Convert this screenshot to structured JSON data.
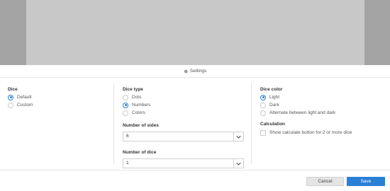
{
  "settings_bar": {
    "label": "Settings",
    "icon": "gear-icon"
  },
  "dice": {
    "title": "Dice",
    "options": [
      {
        "label": "Default",
        "checked": true
      },
      {
        "label": "Custom",
        "checked": false
      }
    ]
  },
  "dice_type": {
    "title": "Dice type",
    "options": [
      {
        "label": "Dots",
        "checked": false
      },
      {
        "label": "Numbers",
        "checked": true
      },
      {
        "label": "Colors",
        "checked": false
      }
    ],
    "sides": {
      "label": "Number of sides",
      "value": "6"
    },
    "count": {
      "label": "Number of dice",
      "value": "1"
    }
  },
  "dice_color": {
    "title": "Dice color",
    "options": [
      {
        "label": "Light",
        "checked": true
      },
      {
        "label": "Dark",
        "checked": false
      },
      {
        "label": "Alternate between light and dark",
        "checked": false
      }
    ]
  },
  "calculation": {
    "title": "Calculation",
    "checkbox_label": "Show calculate button for 2 or more dice",
    "checked": false
  },
  "footer": {
    "cancel_label": "Cancel",
    "save_label": "Save"
  },
  "colors": {
    "accent": "#2a7fd6",
    "preview_bg": "#a4a4a4",
    "stage_bg": "#c8c8c8"
  }
}
